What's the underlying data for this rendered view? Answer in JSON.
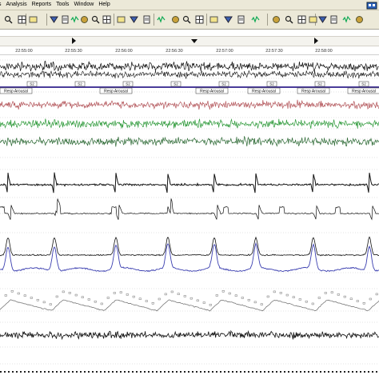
{
  "menu": {
    "items": [
      {
        "label": "s"
      },
      {
        "label": "Analysis"
      },
      {
        "label": "Reports"
      },
      {
        "label": "Tools"
      },
      {
        "label": "Window"
      },
      {
        "label": "Help"
      }
    ]
  },
  "toolbar": {
    "buttons": [
      "search-icon",
      "zoom-icon",
      "layout-icon",
      "layout-icon",
      "layout-icon",
      "layout-icon",
      "grid-icon",
      "grid-icon",
      "event-icon",
      "filter-icon",
      "marker-icon",
      "arrow-left-icon",
      "arrow-right-icon",
      "zoom-in-icon",
      "zoom-out-icon",
      "ruler-icon",
      "flag-icon",
      "bar-icon",
      "waveform-icon",
      "settings-icon",
      "clock-icon",
      "montage-icon",
      "lock-icon",
      "person-icon",
      "light-icon",
      "save-icon",
      "print-icon",
      "help-icon"
    ]
  },
  "timeline": {
    "ticks": [
      "22:55:00",
      "22:55:30",
      "22:56:00",
      "22:56:30",
      "22:57:00",
      "22:57:30",
      "22:58:00"
    ]
  },
  "events": {
    "short_label": "S2",
    "arousal_label": "Resp Arousal"
  },
  "colors": {
    "toolbar_bg": "#ece9d8",
    "eeg_black": "#111111",
    "emg_red": "#b4555a",
    "emg_green": "#2f9a3b",
    "emg_dark_green": "#2d6a35",
    "flow_blue": "#3b3fb0",
    "spo2_gray": "#666666",
    "event_purple": "#4a3c9a"
  }
}
